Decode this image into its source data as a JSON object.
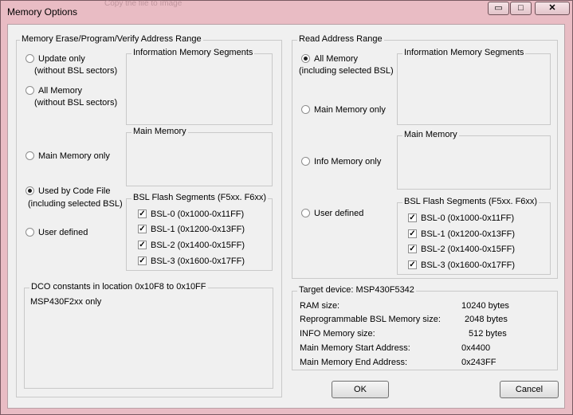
{
  "window": {
    "title": "Memory Options",
    "ghost_caption": "Copy the file to Image",
    "min_glyph": "▭",
    "max_glyph": "□",
    "close_glyph": "✕"
  },
  "left": {
    "group_title": "Memory Erase/Program/Verify Address Range",
    "radios": [
      {
        "line1": "Update only",
        "line2": "(without BSL sectors)",
        "selected": false
      },
      {
        "line1": "All Memory",
        "line2": "(without BSL sectors)",
        "selected": false
      },
      {
        "line1": "Main Memory only",
        "line2": "",
        "selected": false
      },
      {
        "line1": "Used by Code File",
        "line2": "(including selected BSL)",
        "selected": true
      },
      {
        "line1": "User defined",
        "line2": "",
        "selected": false
      }
    ],
    "info_segments_title": "Information Memory Segments",
    "main_memory_title": "Main Memory",
    "bsl_title": "BSL Flash Segments (F5xx. F6xx)",
    "bsl": [
      {
        "label": "BSL-0 (0x1000-0x11FF)",
        "checked": true
      },
      {
        "label": "BSL-1 (0x1200-0x13FF)",
        "checked": true
      },
      {
        "label": "BSL-2 (0x1400-0x15FF)",
        "checked": true
      },
      {
        "label": "BSL-3 (0x1600-0x17FF)",
        "checked": true
      }
    ],
    "dco_title": "DCO constants in location 0x10F8 to 0x10FF",
    "dco_text": "MSP430F2xx only"
  },
  "right": {
    "group_title": "Read Address Range",
    "radios": [
      {
        "line1": "All Memory",
        "line2": "(including selected BSL)",
        "selected": true
      },
      {
        "line1": "Main Memory only",
        "line2": "",
        "selected": false
      },
      {
        "line1": "Info Memory only",
        "line2": "",
        "selected": false
      },
      {
        "line1": "User defined",
        "line2": "",
        "selected": false
      }
    ],
    "info_segments_title": "Information Memory Segments",
    "main_memory_title": "Main Memory",
    "bsl_title": "BSL Flash Segments (F5xx. F6xx)",
    "bsl": [
      {
        "label": "BSL-0 (0x1000-0x11FF)",
        "checked": true
      },
      {
        "label": "BSL-1 (0x1200-0x13FF)",
        "checked": true
      },
      {
        "label": "BSL-2 (0x1400-0x15FF)",
        "checked": true
      },
      {
        "label": "BSL-3 (0x1600-0x17FF)",
        "checked": true
      }
    ]
  },
  "target": {
    "title": "Target device:  MSP430F5342",
    "rows": [
      {
        "label": "RAM size:",
        "value": "10240  bytes"
      },
      {
        "label": "Reprogrammable BSL Memory size:",
        "value": "2048  bytes"
      },
      {
        "label": "INFO Memory size:",
        "value": "512  bytes"
      },
      {
        "label": "Main Memory Start Address:",
        "value": "0x4400"
      },
      {
        "label": "Main Memory End Address:",
        "value": "0x243FF"
      }
    ]
  },
  "buttons": {
    "ok": "OK",
    "cancel": "Cancel"
  },
  "check_glyph": "✓"
}
